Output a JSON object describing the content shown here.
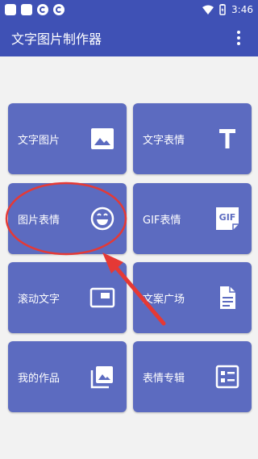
{
  "status": {
    "time": "3:46"
  },
  "toolbar": {
    "title": "文字图片制作器"
  },
  "tiles": [
    {
      "label": "文字图片",
      "icon": "image-icon"
    },
    {
      "label": "文字表情",
      "icon": "text-t-icon"
    },
    {
      "label": "图片表情",
      "icon": "smiley-icon"
    },
    {
      "label": "GIF表情",
      "icon": "gif-icon"
    },
    {
      "label": "滚动文字",
      "icon": "scroll-text-icon"
    },
    {
      "label": "文案广场",
      "icon": "document-icon"
    },
    {
      "label": "我的作品",
      "icon": "photo-library-icon"
    },
    {
      "label": "表情专辑",
      "icon": "album-list-icon"
    }
  ],
  "colors": {
    "primary": "#3f51b5",
    "tile": "#5c6bc0",
    "annotation": "#e53935"
  }
}
